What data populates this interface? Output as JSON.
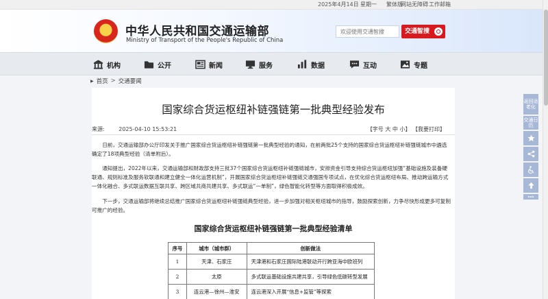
{
  "topbar": {
    "date": "2025年4月14日",
    "weekday": "星期一",
    "traditional": "繁体版",
    "accessibility": "网站无障碍",
    "email": "工作邮箱"
  },
  "header": {
    "cn_title": "中华人民共和国交通运输部",
    "en_title": "Ministry of Transport of the People's Republic of China",
    "search_placeholder": "欢迎使用交通智搜",
    "brand_button": "交通智搜"
  },
  "nav": [
    {
      "label": "机构",
      "icon": "building-icon"
    },
    {
      "label": "公开",
      "icon": "folder-icon"
    },
    {
      "label": "新闻",
      "icon": "newspaper-icon"
    },
    {
      "label": "服务",
      "icon": "service-desk-icon"
    },
    {
      "label": "数据",
      "icon": "bar-chart-icon"
    },
    {
      "label": "互动",
      "icon": "chat-icon"
    },
    {
      "label": "专题",
      "icon": "picture-icon"
    }
  ],
  "breadcrumb": {
    "home": "首页",
    "separator": ">",
    "section": "交通要闻"
  },
  "article": {
    "title": "国家综合货运枢纽补链强链第一批典型经验发布",
    "source_label": "来源:",
    "date": "2025-04-10 15:53:21",
    "font_label": "【字号",
    "font_large": "大",
    "font_medium": "中",
    "font_small": "小",
    "font_close": "】",
    "print": "【我要打印】",
    "paragraphs": [
      "日前，交通运输部办公厅印发关于推广国家综合货运枢纽补链强链第一批典型经验的通知，在前两批25个支持的国家综合货运枢纽补链强链城市中遴选确定了18项典型经验（清单附后）。",
      "通知提出，2022年以来，交通运输部和财政部支持三批37个国家综合货运枢纽补链强链城市，安排资金引导支持综合货运枢纽加强“基础设施及装备硬联通、规则标准及服务软联通和建立健全一体化运营机制”，开展国家综合货运枢纽补链强链交通强国专项试点，在优化综合货运枢纽布局、推动跨运输方式一体化融合、多式联运数据互联共享、跨区域共商共建共享、多式联运“一单制”，绿色智能化转型等方面取得积极成效。",
      "下一步，交通运输部将继续总结推广国家综合货运枢纽补链强链典型经验，进一步加强对相关枢纽城市的指导，鼓励探索创新，力争尽快形成更多可复制可推广的经验。"
    ],
    "table_title": "国家综合货运枢纽补链强链第一批典型经验清单",
    "table_headers": [
      "序号",
      "城市（城市群）",
      "创新做法"
    ],
    "table_rows": [
      [
        "1",
        "天津、石家庄",
        "天津港和石家庄国际陆港联动开行跨亚海中欧班列"
      ],
      [
        "2",
        "太原",
        "多式联运基础设施共建共享，引导绿色低碳转型发展"
      ],
      [
        "3",
        "连云港—徐州—淮安",
        "连云港深入开展“信息+监管”等探索"
      ]
    ]
  },
  "side_tools": {
    "elderly": "返回适老化",
    "exit": "交通日历",
    "favorite_icon": "star-icon",
    "share_icon": "share-icon",
    "access_icon": "wheelchair-icon",
    "top_icon": "arrow-up-icon",
    "more_icon": "dots-icon"
  },
  "colors": {
    "brand_red": "#d71920",
    "side_blue": "#a7b7d6",
    "nav_bg": "#e7eaef"
  }
}
